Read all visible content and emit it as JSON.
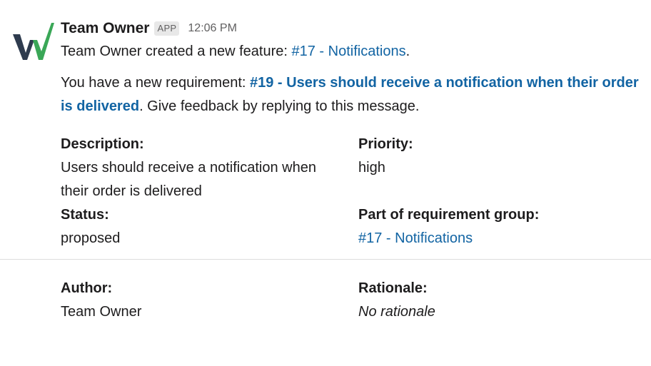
{
  "message": {
    "sender": "Team Owner",
    "app_badge": "APP",
    "time": "12:06 PM",
    "line1_prefix": "Team Owner created a new feature: ",
    "line1_link": "#17 - Notifications",
    "line1_suffix": ".",
    "para_prefix": "You have a new requirement: ",
    "para_link": "#19 - Users should receive a notification when their order is delivered",
    "para_suffix": ". Give feedback by replying to this message."
  },
  "fields": {
    "description_label": "Description:",
    "description_value": "Users should receive a notification when their order is delivered",
    "priority_label": "Priority:",
    "priority_value": "high",
    "status_label": "Status:",
    "status_value": "proposed",
    "group_label": "Part of requirement group:",
    "group_value": "#17 - Notifications",
    "author_label": "Author:",
    "author_value": "Team Owner",
    "rationale_label": "Rationale:",
    "rationale_value": "No rationale"
  },
  "colors": {
    "link": "#1264a3",
    "logo_dark": "#2e3b4e",
    "logo_green": "#3aa757"
  }
}
